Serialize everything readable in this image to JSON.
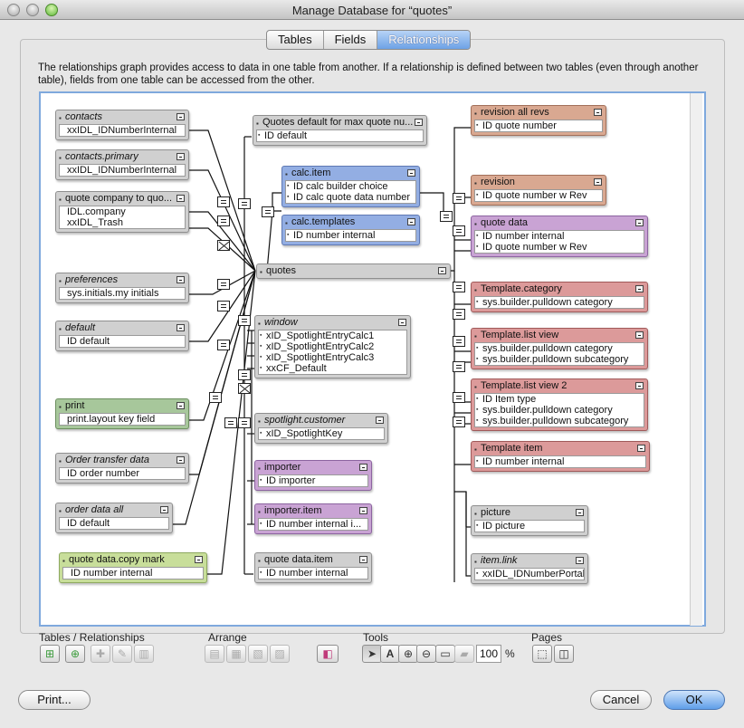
{
  "window": {
    "title": "Manage Database for “quotes”"
  },
  "tabs": [
    {
      "label": "Tables",
      "selected": false
    },
    {
      "label": "Fields",
      "selected": false
    },
    {
      "label": "Relationships",
      "selected": true
    }
  ],
  "description": "The relationships graph provides access to data in one table from another. If a relationship is defined between two tables (even through another table), fields from one table can be accessed from the other.",
  "tables": {
    "contacts": {
      "name": "contacts",
      "fields": [
        "xxIDL_IDNumberInternal"
      ]
    },
    "contacts_primary": {
      "name": "contacts.primary",
      "fields": [
        "xxIDL_IDNumberInternal"
      ]
    },
    "quote_company": {
      "name": "quote company to quo...",
      "fields": [
        "IDL.company",
        "xxIDL_Trash"
      ]
    },
    "preferences": {
      "name": "preferences",
      "fields": [
        "sys.initials.my initials"
      ]
    },
    "default": {
      "name": "default",
      "fields": [
        "ID default"
      ]
    },
    "print": {
      "name": "print",
      "fields": [
        "print.layout key field"
      ]
    },
    "order_transfer": {
      "name": "Order transfer data",
      "fields": [
        "ID order number"
      ]
    },
    "order_data_all": {
      "name": "order data all",
      "fields": [
        "ID default"
      ]
    },
    "quote_copy_mark": {
      "name": "quote data.copy mark",
      "fields": [
        "ID number internal"
      ]
    },
    "quotes_default": {
      "name": "Quotes default for max quote nu...",
      "fields": [
        "ID default"
      ]
    },
    "calc_item": {
      "name": "calc.item",
      "fields": [
        "ID calc builder choice",
        "ID calc quote data number"
      ]
    },
    "calc_templates": {
      "name": "calc.templates",
      "fields": [
        "ID number internal"
      ]
    },
    "quotes": {
      "name": "quotes"
    },
    "window": {
      "name": "window",
      "fields": [
        "xID_SpotlightEntryCalc1",
        "xID_SpotlightEntryCalc2",
        "xID_SpotlightEntryCalc3",
        "xxCF_Default"
      ]
    },
    "spotlight_customer": {
      "name": "spotlight.customer",
      "fields": [
        "xID_SpotlightKey"
      ]
    },
    "importer": {
      "name": "importer",
      "fields": [
        "ID importer"
      ]
    },
    "importer_item": {
      "name": "importer.item",
      "fields": [
        "ID number internal i..."
      ]
    },
    "quote_data_item": {
      "name": "quote data.item",
      "fields": [
        "ID number internal"
      ]
    },
    "revision_all": {
      "name": "revision all revs",
      "fields": [
        "ID quote number"
      ]
    },
    "revision": {
      "name": "revision",
      "fields": [
        "ID quote number w Rev"
      ]
    },
    "quote_data": {
      "name": "quote data",
      "fields": [
        "ID number internal",
        "ID quote number w Rev"
      ]
    },
    "template_category": {
      "name": "Template.category",
      "fields": [
        "sys.builder.pulldown category"
      ]
    },
    "template_list_view": {
      "name": "Template.list view",
      "fields": [
        "sys.builder.pulldown category",
        "sys.builder.pulldown subcategory"
      ]
    },
    "template_list_view2": {
      "name": "Template.list view 2",
      "fields": [
        "ID Item type",
        "sys.builder.pulldown category",
        "sys.builder.pulldown subcategory"
      ]
    },
    "template_item": {
      "name": "Template item",
      "fields": [
        "ID number internal"
      ]
    },
    "picture": {
      "name": "picture",
      "fields": [
        "ID picture"
      ]
    },
    "item_link": {
      "name": "item.link",
      "fields": [
        "xxIDL_IDNumberPortal"
      ]
    }
  },
  "colors": {
    "gray": "#d0d0d0",
    "blue": "#93aee3",
    "orange": "#d9a891",
    "purple": "#c9a3d4",
    "red": "#dc9a9a",
    "green": "#a7c79b",
    "lime": "#c8de9a",
    "accent": "#5f9ee9"
  },
  "toolbar": {
    "tables_label": "Tables / Relationships",
    "arrange_label": "Arrange",
    "tools_label": "Tools",
    "pages_label": "Pages",
    "zoom_value": "100",
    "zoom_unit": "%"
  },
  "icons": {
    "add_table": "add-table-icon",
    "add_relationship": "add-relationship-icon",
    "duplicate": "duplicate-icon",
    "edit": "pencil-icon",
    "delete": "trash-icon",
    "pointer": "arrow-pointer-icon",
    "text": "text-tool-icon",
    "zoom_in": "zoom-in-icon",
    "zoom_out": "zoom-out-icon"
  },
  "buttons": {
    "print": "Print...",
    "cancel": "Cancel",
    "ok": "OK"
  }
}
